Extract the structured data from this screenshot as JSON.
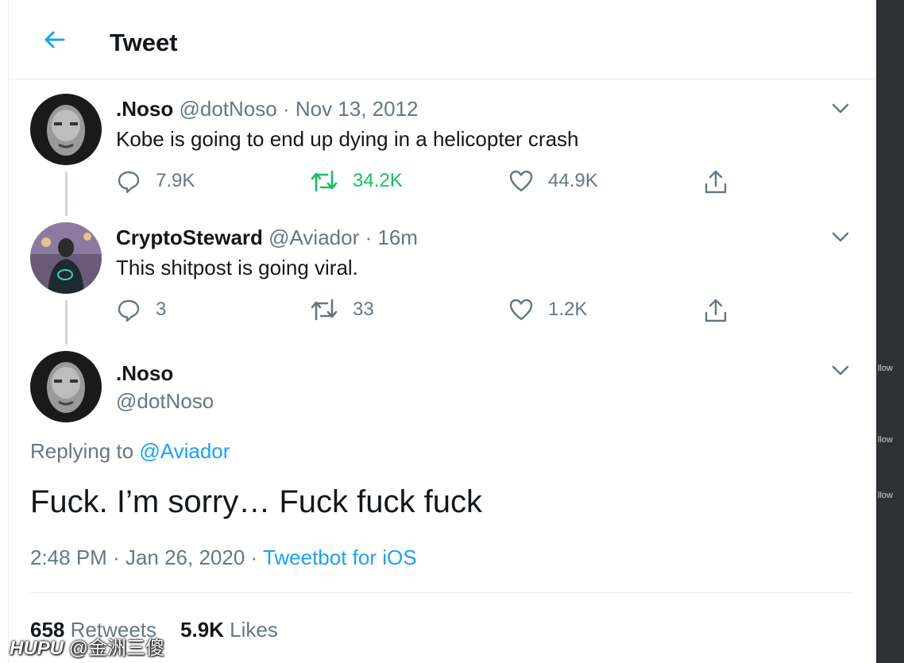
{
  "header": {
    "title": "Tweet",
    "back_icon": "arrow-left-icon",
    "accent": "#1da1f2"
  },
  "thread": [
    {
      "name": ".Noso",
      "handle": "@dotNoso",
      "separator": "·",
      "time": "Nov 13, 2012",
      "text": "Kobe is going to end up dying in a helicopter crash",
      "replies": "7.9K",
      "retweets": "34.2K",
      "likes": "44.9K"
    },
    {
      "name": "CryptoSteward",
      "handle": "@Aviador",
      "separator": "·",
      "time": "16m",
      "text": "This shitpost is going viral.",
      "replies": "3",
      "retweets": "33",
      "likes": "1.2K"
    }
  ],
  "focus": {
    "name": ".Noso",
    "handle": "@dotNoso",
    "replying_prefix": "Replying to",
    "replying_to": "@Aviador",
    "text": "Fuck. I’m sorry… Fuck fuck fuck",
    "time": "2:48 PM · Jan 26, 2020 ·",
    "source": "Tweetbot for iOS",
    "retweets_count": "658",
    "retweets_label": "Retweets",
    "likes_count": "5.9K",
    "likes_label": "Likes"
  },
  "side_panel": {
    "follow_fragments": [
      "llow",
      "llow",
      "llow"
    ]
  },
  "watermark": {
    "brand": "HUPU",
    "user": "@金洲三傻"
  },
  "colors": {
    "retweet_active": "#17bf63",
    "muted": "#657786",
    "text": "#14171a"
  }
}
